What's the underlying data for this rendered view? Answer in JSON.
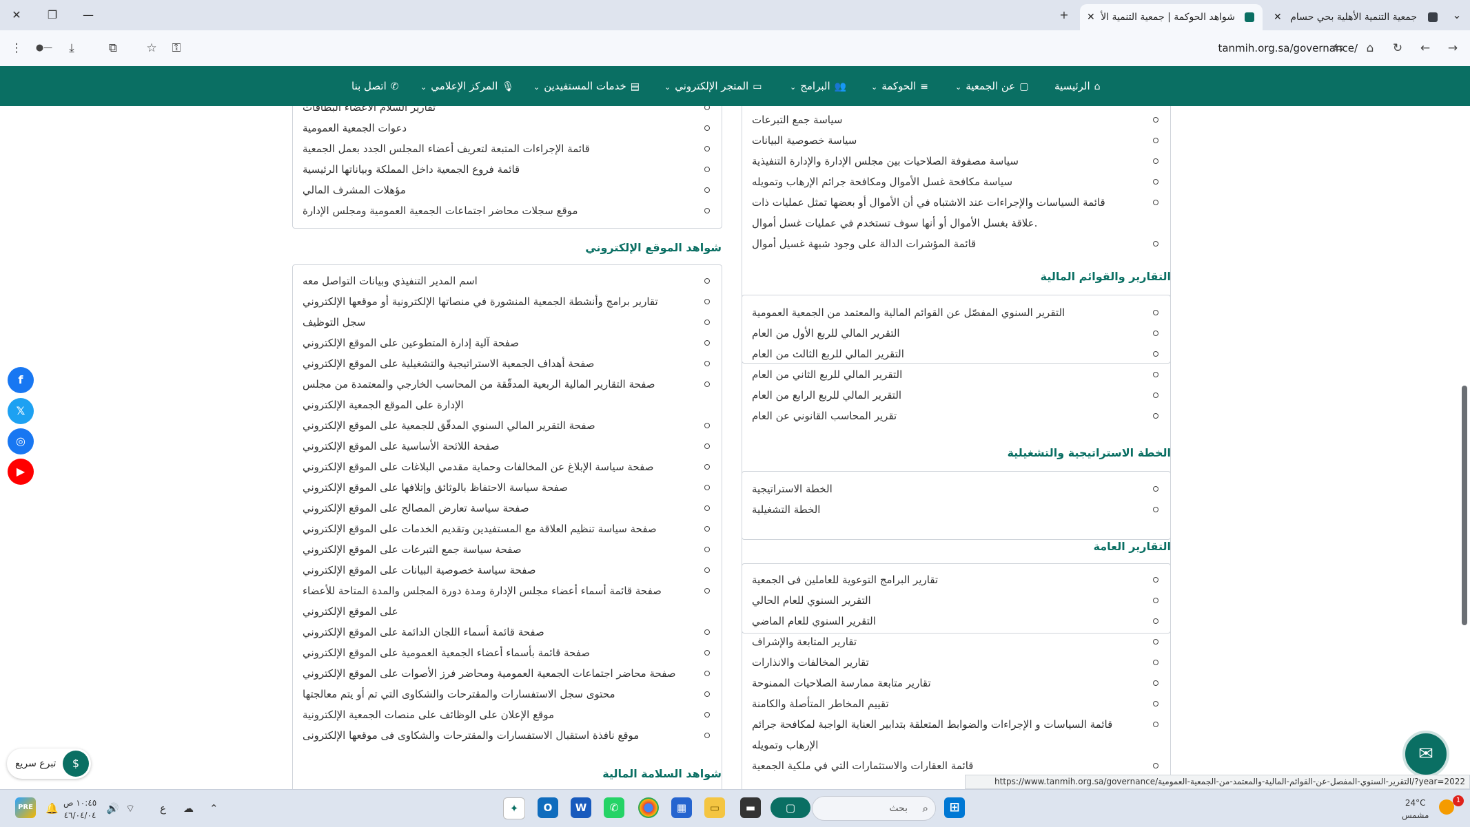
{
  "browser": {
    "tabs": [
      {
        "title": "جمعية التنمية الأهلية بحي حسام"
      },
      {
        "title": "شواهد الحوكمة | جمعية التنمية الأ"
      }
    ],
    "url": "tanmih.org.sa/governance/"
  },
  "nav": {
    "items": [
      {
        "label": "الرئيسية"
      },
      {
        "label": "عن الجمعية"
      },
      {
        "label": "الحوكمة"
      },
      {
        "label": "البرامج"
      },
      {
        "label": "المتجر الإلكتروني"
      },
      {
        "label": "خدمات المستفيدين"
      },
      {
        "label": "المركز الإعلامي"
      },
      {
        "label": "اتصل بنا"
      }
    ]
  },
  "right_col": {
    "policies_items": [
      "سياسة جمع التبرعات",
      "سياسة خصوصية البيانات",
      "سياسة مصفوفة الصلاحيات بين مجلس الإدارة والإدارة التنفيذية",
      "سياسة مكافحة غسل الأموال ومكافحة جرائم الإرهاب وتمويله",
      "قائمة السياسات والإجراءات عند الاشتباه في أن الأموال أو بعضها تمثل عمليات ذات",
      "علاقة بغسل الأموال أو أنها سوف تستخدم في عمليات غسل أموال.",
      "قائمة المؤشرات الدالة على وجود شبهة غسيل أموال"
    ],
    "financial_title": "التقارير والقوائم المالية",
    "financial_items": [
      "التقرير السنوي المفصّل عن القوائم المالية والمعتمد من الجمعية العمومية",
      "التقرير المالي للربع الأول من العام",
      "التقرير المالي للربع الثالث من العام",
      "التقرير المالي للربع الثاني من العام",
      "التقرير المالي للربع الرابع من العام",
      "تقرير المحاسب القانوني عن العام"
    ],
    "strategy_title": "الخطة الاستراتيجية والتشغيلية",
    "strategy_items": [
      "الخطة الاستراتيجية",
      "الخطة التشغيلية"
    ],
    "general_title": "التقارير العامة",
    "general_items": [
      "تقارير البرامج التوعوية للعاملين فى الجمعية",
      "التقرير السنوي للعام الحالي",
      "التقرير السنوي للعام الماضي",
      "تقارير المتابعة والإشراف",
      "تقارير المخالفات والانذارات",
      "تقارير متابعة ممارسة الصلاحيات الممنوحة",
      "تقييم المخاطر المتأصلة والكامنة",
      "قائمة السياسات و الإجراءات والضوابط المتعلقة بتدابير العناية الواجبة لمكافحة جرائم",
      "الإرهاب وتمويله",
      "قائمة العقارات والاستثمارات التي في ملكية الجمعية"
    ]
  },
  "left_col": {
    "top_items": [
      "تقارير السلام الأعضاء البطاقات",
      "دعوات الجمعية العمومية",
      "قائمة الإجراءات المتبعة لتعريف أعضاء المجلس الجدد بعمل الجمعية",
      "قائمة فروع الجمعية داخل المملكة وبياناتها الرئيسية",
      "مؤهلات المشرف المالي",
      "موقع سجلات محاضر اجتماعات الجمعية العمومية ومجلس الإدارة"
    ],
    "website_title": "شواهد الموقع الإلكتروني",
    "website_items": [
      "اسم المدير التنفيذي وبيانات التواصل معه",
      "تقارير برامج وأنشطة الجمعية المنشورة في منصاتها الإلكترونية أو موقعها الإلكتروني",
      "سجل التوظيف",
      "صفحة آلية إدارة المتطوعين على الموقع الإلكتروني",
      "صفحة أهداف الجمعية الاستراتيجية والتشغيلية على الموقع الإلكتروني",
      "صفحة التقارير المالية الربعية المدقّقة من المحاسب الخارجي والمعتمدة من مجلس",
      "الإدارة على الموقع الجمعية الإلكتروني",
      "صفحة التقرير المالي السنوي المدقّق للجمعية على الموقع الإلكتروني",
      "صفحة اللائحة الأساسية على الموقع الإلكتروني",
      "صفحة سياسة الإبلاغ عن المخالفات وحماية مقدمي البلاغات على الموقع الإلكتروني",
      "صفحة سياسة الاحتفاظ بالوثائق وإتلافها على الموقع الإلكتروني",
      "صفحة سياسة تعارض المصالح على الموقع الإلكتروني",
      "صفحة سياسة تنظيم العلاقة مع المستفيدين وتقديم الخدمات على الموقع الإلكتروني",
      "صفحة سياسة جمع التبرعات على الموقع الإلكتروني",
      "صفحة سياسة خصوصية البيانات على الموقع الإلكتروني",
      "صفحة قائمة أسماء أعضاء مجلس الإدارة ومدة دورة المجلس والمدة المتاحة للأعضاء",
      "على الموقع الإلكتروني",
      "صفحة قائمة أسماء اللجان الدائمة على الموقع الإلكتروني",
      "صفحة قائمة بأسماء أعضاء الجمعية العمومية على الموقع الإلكتروني",
      "صفحة محاضر اجتماعات الجمعية العمومية ومحاضر فرز الأصوات على الموقع الإلكتروني",
      "محتوى سجل الاستفسارات والمقترحات والشكاوى التي تم أو يتم معالجتها",
      "موقع الإعلان على الوظائف على منصات الجمعية الإلكترونية",
      "موقع نافذة استقبال الاستفسارات والمقترحات والشكاوى فى موقعها الإلكترونى"
    ],
    "financial_safety_title": "شواهد السلامة المالية"
  },
  "widgets": {
    "donate_label": "تبرع سريع",
    "status_url": "https://www.tanmih.org.sa/governance/التقرير-السنوي-المفصل-عن-القوائم-المالية-والمعتمد-من-الجمعية-العمومية/?year=2022"
  },
  "taskbar": {
    "weather_temp": "24°C",
    "weather_desc": "مشمس",
    "search_placeholder": "بحث",
    "time": "١٠:٤٥ ص",
    "date": "٤٦/٠٤/٠٤",
    "lang": "ع",
    "notification_count": "1"
  },
  "colors": {
    "brand": "#0a6f63",
    "facebook": "#1877f2",
    "twitter": "#1da1f2",
    "instagram": "#1877f2",
    "youtube": "#ff0000"
  }
}
